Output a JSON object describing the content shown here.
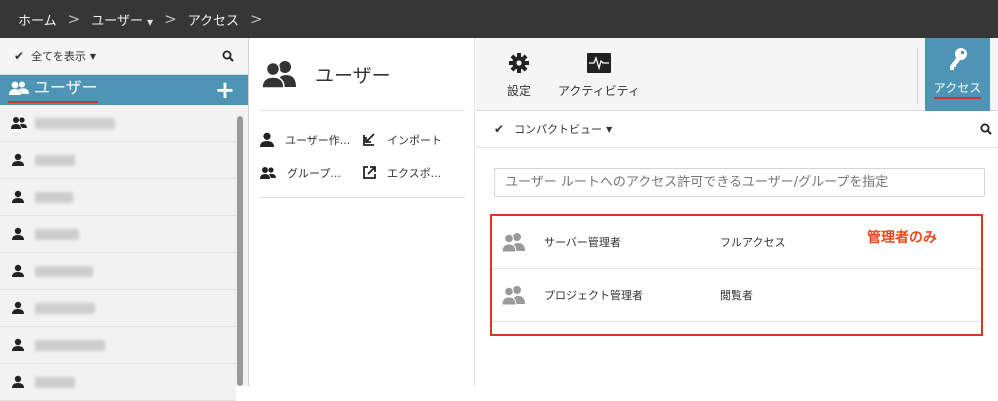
{
  "breadcrumb": {
    "home": "ホーム",
    "users": "ユーザー",
    "access": "アクセス"
  },
  "left": {
    "filter_label": "全てを表示",
    "section_title": "ユーザー",
    "row_count": 8
  },
  "middle": {
    "title": "ユーザー",
    "actions": {
      "create_user": "ユーザー作...",
      "import": "インポート",
      "group": "グループ...",
      "export": "エクスポ..."
    }
  },
  "right": {
    "tabs": {
      "settings": "設定",
      "activity": "アクティビティ",
      "access": "アクセス"
    },
    "view_label": "コンパクトビュー",
    "spec_placeholder": "ユーザー ルートへのアクセス許可できるユーザー/グループを指定",
    "entries": [
      {
        "name": "サーバー管理者",
        "permission": "フルアクセス"
      },
      {
        "name": "プロジェクト管理者",
        "permission": "閲覧者"
      }
    ],
    "annotation": "管理者のみ"
  },
  "colors": {
    "accent_blue": "#4e94b5",
    "highlight_red": "#d9391f",
    "topbar": "#363636"
  }
}
